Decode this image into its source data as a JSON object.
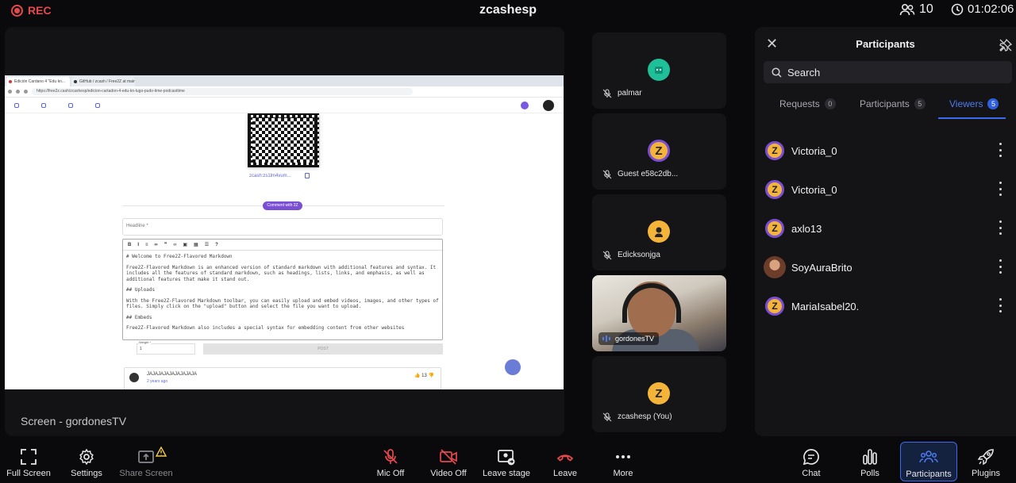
{
  "topbar": {
    "rec_label": "REC",
    "meeting_title": "zcashesp",
    "participant_count": "10",
    "timer": "01:02:06"
  },
  "stage": {
    "screen_label": "Screen - gordonesTV",
    "browser": {
      "tabs": [
        "Edición Cardano 4 \"Edu kn...",
        "GitHub / zcash / Free2Z at main · Fr..."
      ],
      "url": "https://free2z.cash/zcashesp/edicion-cartadon-4-edu-kn-lugo-pudo-time-podcasttime",
      "zaddr": "zcash:zs1lm4vum...",
      "comment_button": "Comment with 2Z",
      "headline_placeholder": "Headline *",
      "editor_lines": [
        "# Welcome to Free2Z-Flavored Markdown",
        "Free2Z-Flavored Markdown is an enhanced version of standard markdown with additional features and syntax. It includes all the features of standard markdown, such as headings, lists, links, and emphasis, as well as additional features that make it stand out.",
        "## Uploads",
        "With the Free2Z-Flavored Markdown toolbar, you can easily upload and embed videos, images, and other types of files. Simply click on the \"upload\" button and select the file you want to upload.",
        "## Embeds",
        "Free2Z-Flavored Markdown also includes a special syntax for embedding content from other websites"
      ],
      "weight_label": "Weight *",
      "weight_value": "1",
      "post_label": "POST",
      "comment": {
        "name": "JAJAJAJAJAJAJAJAJA",
        "time": "2 years ago",
        "likes": "13"
      }
    }
  },
  "tiles": [
    {
      "name": "palmar",
      "avatar_color": "#1fbf9a"
    },
    {
      "name": "Guest e58c2db...",
      "avatar_color": "#f4b43a"
    },
    {
      "name": "Edicksonjga",
      "avatar_color": "#f4b43a"
    },
    {
      "name": "gordonesTV"
    },
    {
      "name": "zcashesp (You)",
      "avatar_color": "#f4b43a"
    }
  ],
  "panel": {
    "title": "Participants",
    "search_placeholder": "Search",
    "tabs": [
      {
        "label": "Requests",
        "count": "0"
      },
      {
        "label": "Participants",
        "count": "5"
      },
      {
        "label": "Viewers",
        "count": "5"
      }
    ],
    "active_tab": "Viewers",
    "viewers": [
      {
        "name": "Victoria_0"
      },
      {
        "name": "Victoria_0"
      },
      {
        "name": "axlo13"
      },
      {
        "name": "SoyAuraBrito"
      },
      {
        "name": "MariaIsabel20."
      }
    ]
  },
  "toolbar": {
    "full_screen": "Full Screen",
    "settings": "Settings",
    "share_screen": "Share Screen",
    "mic_off": "Mic Off",
    "video_off": "Video Off",
    "leave_stage": "Leave stage",
    "leave": "Leave",
    "more": "More",
    "chat": "Chat",
    "polls": "Polls",
    "participants": "Participants",
    "plugins": "Plugins"
  },
  "colors": {
    "record": "#e5484d",
    "accent": "#3b6af0",
    "muted_red": "#e5484d"
  }
}
